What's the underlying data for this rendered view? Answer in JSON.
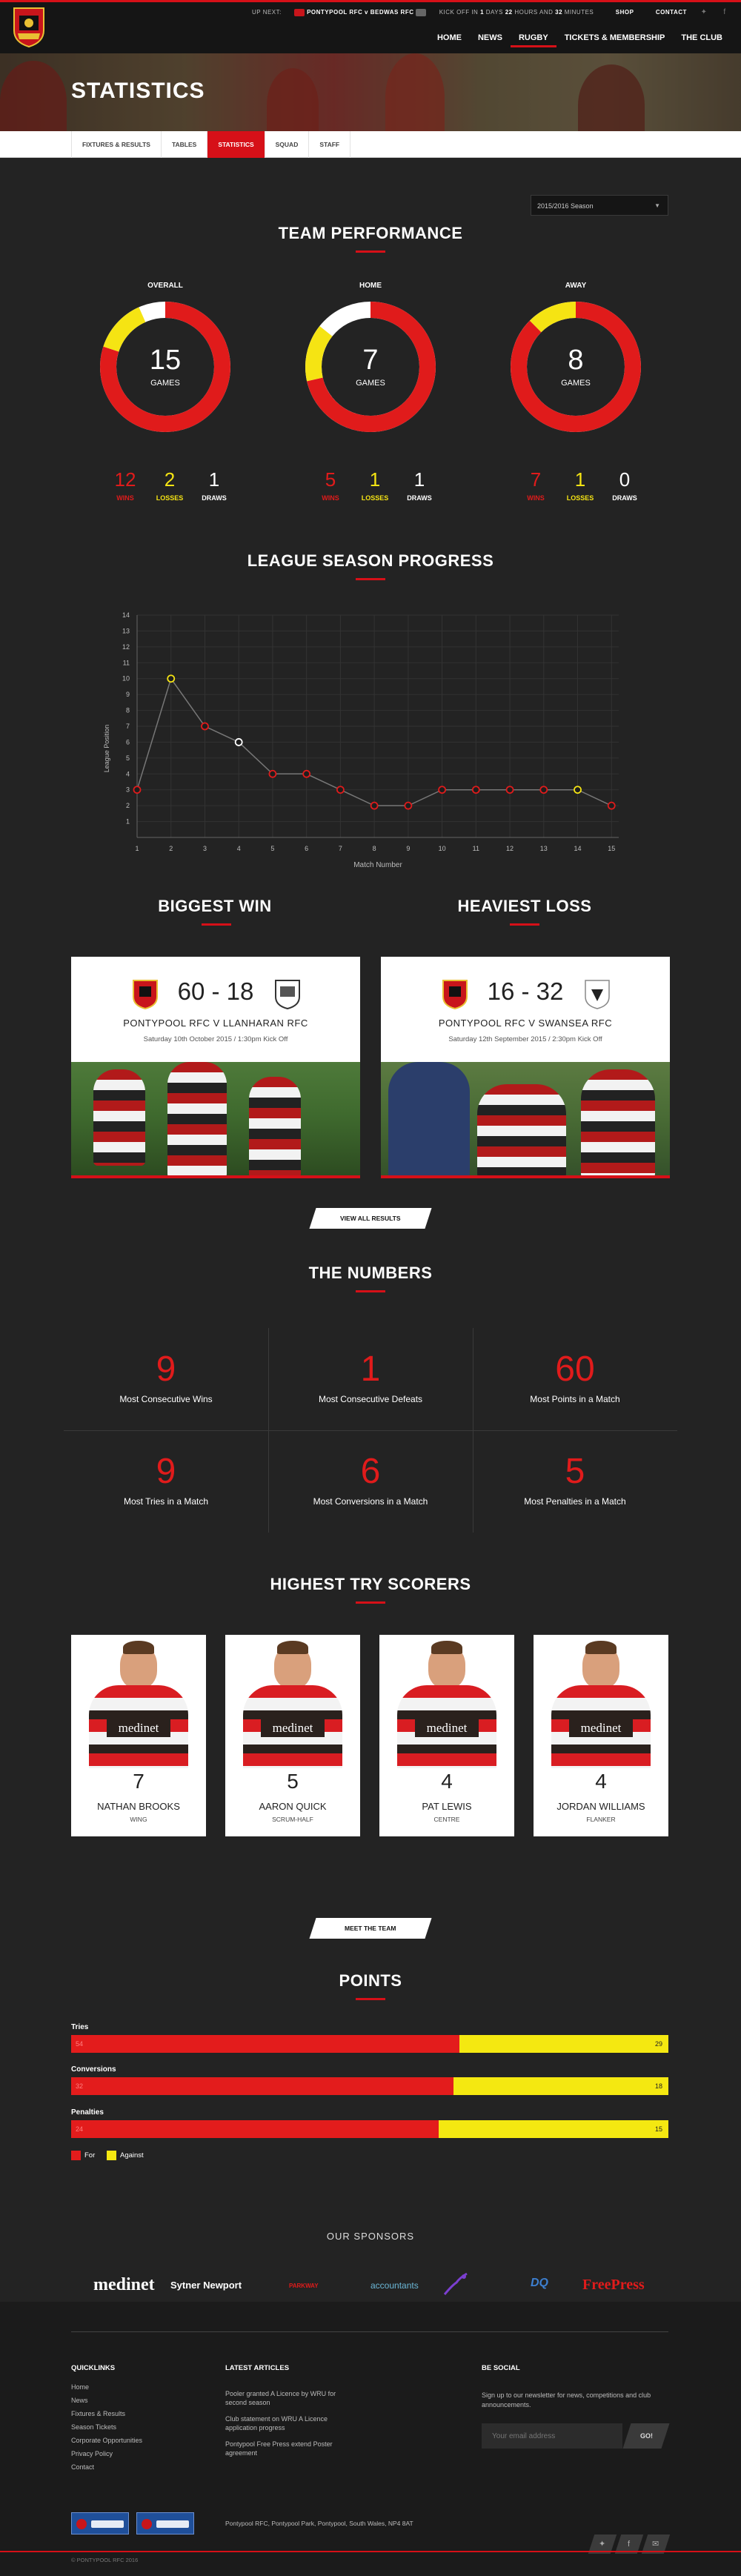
{
  "header": {
    "topline": {
      "prefix": "UP NEXT:",
      "fixture": "PONTYPOOL RFC v BEDWAS RFC",
      "kickoff_label": "KICK OFF IN",
      "days": "1",
      "days_label": "DAYS",
      "hours": "22",
      "hours_label": "HOURS AND",
      "minutes": "32",
      "minutes_label": "MINUTES",
      "shop": "SHOP",
      "contact": "CONTACT"
    },
    "nav": [
      "HOME",
      "NEWS",
      "RUGBY",
      "TICKETS & MEMBERSHIP",
      "THE CLUB"
    ],
    "active_nav": "RUGBY"
  },
  "hero": {
    "title": "STATISTICS"
  },
  "subnav": {
    "tabs": [
      "FIXTURES & RESULTS",
      "TABLES",
      "STATISTICS",
      "SQUAD",
      "STAFF"
    ],
    "active": "STATISTICS"
  },
  "team_performance": {
    "title": "TEAM PERFORMANCE",
    "season_select": "2015/2016 Season",
    "games_label": "GAMES",
    "blocks": [
      {
        "label": "OVERALL",
        "games": "15",
        "wins": 12,
        "losses": 2,
        "draws": 1
      },
      {
        "label": "HOME",
        "games": "7",
        "wins": 5,
        "losses": 1,
        "draws": 1
      },
      {
        "label": "AWAY",
        "games": "8",
        "wins": 7,
        "losses": 1,
        "draws": 0
      }
    ],
    "wins_label": "WINS",
    "losses_label": "LOSSES",
    "draws_label": "DRAWS"
  },
  "league_progress": {
    "title": "LEAGUE SEASON PROGRESS"
  },
  "chart_data": {
    "type": "line",
    "title": "LEAGUE SEASON PROGRESS",
    "xlabel": "Match Number",
    "ylabel": "League Position",
    "x": [
      1,
      2,
      3,
      4,
      5,
      6,
      7,
      8,
      9,
      10,
      11,
      12,
      13,
      14,
      15
    ],
    "values": [
      3,
      10,
      7,
      6,
      4,
      4,
      3,
      2,
      2,
      3,
      3,
      3,
      3,
      3,
      2
    ],
    "point_colors": [
      "red",
      "yellow",
      "red",
      "white",
      "red",
      "red",
      "red",
      "red",
      "red",
      "red",
      "red",
      "red",
      "red",
      "yellow",
      "red"
    ],
    "xlim": [
      1,
      15
    ],
    "ylim": [
      1,
      14
    ],
    "yticks": [
      1,
      2,
      3,
      4,
      5,
      6,
      7,
      8,
      9,
      10,
      11,
      12,
      13,
      14
    ],
    "grid": true
  },
  "results": {
    "biggest_win_title": "BIGGEST WIN",
    "heaviest_loss_title": "HEAVIEST LOSS",
    "win": {
      "score": "60 - 18",
      "teams": "PONTYPOOL RFC v LLANHARAN RFC",
      "meta": "Saturday 10th October 2015 / 1:30pm Kick Off"
    },
    "loss": {
      "score": "16 - 32",
      "teams": "PONTYPOOL RFC v SWANSEA RFC",
      "meta": "Saturday 12th September 2015 / 2:30pm Kick Off"
    },
    "view_all": "VIEW ALL RESULTS"
  },
  "numbers": {
    "title": "THE NUMBERS",
    "items": [
      {
        "value": "9",
        "label": "Most Consecutive Wins"
      },
      {
        "value": "1",
        "label": "Most Consecutive Defeats"
      },
      {
        "value": "60",
        "label": "Most Points in a Match"
      },
      {
        "value": "9",
        "label": "Most Tries in a Match"
      },
      {
        "value": "6",
        "label": "Most Conversions in a Match"
      },
      {
        "value": "5",
        "label": "Most Penalties in a Match"
      }
    ]
  },
  "try_scorers": {
    "title": "HIGHEST TRY SCORERS",
    "players": [
      {
        "tries": "7",
        "name": "NATHAN BROOKS",
        "position": "WING",
        "sponsor": "medinet"
      },
      {
        "tries": "5",
        "name": "AARON QUICK",
        "position": "SCRUM-HALF",
        "sponsor": "medinet"
      },
      {
        "tries": "4",
        "name": "PAT LEWIS",
        "position": "CENTRE",
        "sponsor": "medinet"
      },
      {
        "tries": "4",
        "name": "JORDAN WILLIAMS",
        "position": "FLANKER",
        "sponsor": "medinet"
      }
    ],
    "meet_team": "MEET THE TEAM"
  },
  "points": {
    "title": "POINTS",
    "rows": [
      {
        "label": "Tries",
        "for": 54,
        "against": 29
      },
      {
        "label": "Conversions",
        "for": 32,
        "against": 18
      },
      {
        "label": "Penalties",
        "for": 24,
        "against": 15
      }
    ],
    "rows_display": [
      {
        "for": "54",
        "against": "29"
      },
      {
        "for": "32",
        "against": "18"
      },
      {
        "for": "24",
        "against": "15"
      }
    ],
    "legend_for": "For",
    "legend_against": "Against",
    "colors": {
      "for": "#e31c1c",
      "against": "#f4e811"
    }
  },
  "sponsors": {
    "title": "OUR SPONSORS",
    "items": [
      "medinet",
      "Sytner Newport",
      "PARKWAY",
      "accountants",
      "DQ",
      "FreePress"
    ]
  },
  "footer": {
    "quicklinks_title": "QUICKLINKS",
    "quicklinks": [
      "Home",
      "News",
      "Fixtures & Results",
      "Season Tickets",
      "Corporate Opportunities",
      "Privacy Policy",
      "Contact"
    ],
    "articles_title": "LATEST ARTICLES",
    "articles": [
      "Pooler granted A Licence by WRU for second season",
      "Club statement on WRU A Licence application progress",
      "Pontypool Free Press extend Poster agreement"
    ],
    "social_title": "BE SOCIAL",
    "social_text": "Sign up to our newsletter for news, competitions and club announcements.",
    "email_placeholder": "Your email address",
    "go": "GO!",
    "address": "Pontypool RFC, Pontypool Park, Pontypool, South Wales, NP4 8AT",
    "copyright": "© PONTYPOOL RFC 2016"
  },
  "colors": {
    "accent": "#d61018",
    "wins": "#e01b1b",
    "losses": "#f5e413",
    "draws": "#ffffff"
  }
}
